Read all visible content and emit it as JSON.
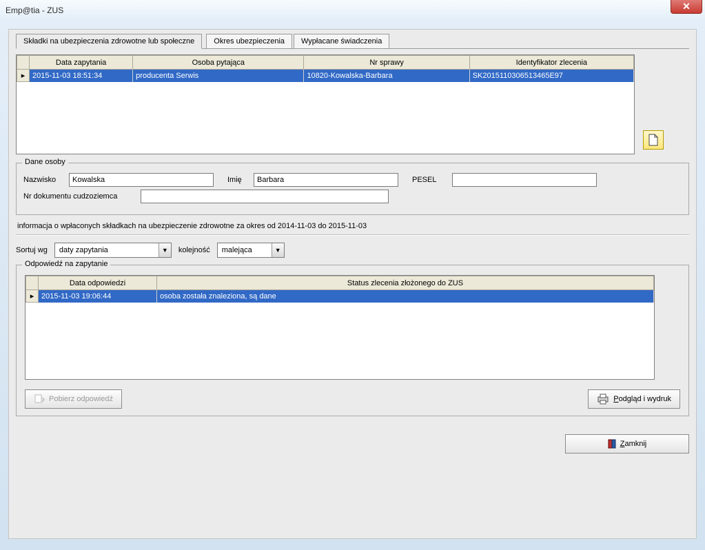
{
  "window": {
    "title": "Emp@tia - ZUS"
  },
  "tabs": {
    "t1": "Składki na ubezpieczenia zdrowotne lub społeczne",
    "t2": "Okres ubezpieczenia",
    "t3": "Wypłacane świadczenia"
  },
  "query_grid": {
    "cols": {
      "c1": "Data zapytania",
      "c2": "Osoba pytająca",
      "c3": "Nr sprawy",
      "c4": "Identyfikator zlecenia"
    },
    "row1": {
      "c1": "2015-11-03 18:51:34",
      "c2": "producenta Serwis",
      "c3": "10820-Kowalska-Barbara",
      "c4": "SK2015110306513465E97"
    }
  },
  "person": {
    "legend": "Dane osoby",
    "labels": {
      "surname": "Nazwisko",
      "first": "Imię",
      "pesel": "PESEL",
      "docnr": "Nr dokumentu cudzoziemca"
    },
    "values": {
      "surname": "Kowalska",
      "first": "Barbara",
      "pesel": "",
      "docnr": ""
    }
  },
  "info_line": "informacja o wpłaconych składkach na ubezpieczenie zdrowotne za okres od 2014-11-03 do 2015-11-03",
  "sort": {
    "label_by": "Sortuj wg",
    "value_by": "daty zapytania",
    "label_order": "kolejność",
    "value_order": "malejąca"
  },
  "response": {
    "legend": "Odpowiedź na zapytanie",
    "cols": {
      "c1": "Data odpowiedzi",
      "c2": "Status zlecenia złożonego do ZUS"
    },
    "row1": {
      "c1": "2015-11-03 19:06:44",
      "c2": "osoba została znaleziona, są dane"
    },
    "btn_fetch": "Pobierz odpowiedź",
    "btn_preview_prefix": "P",
    "btn_preview_rest": "odgląd i wydruk"
  },
  "btn_close_prefix": "Z",
  "btn_close_rest": "amknij"
}
